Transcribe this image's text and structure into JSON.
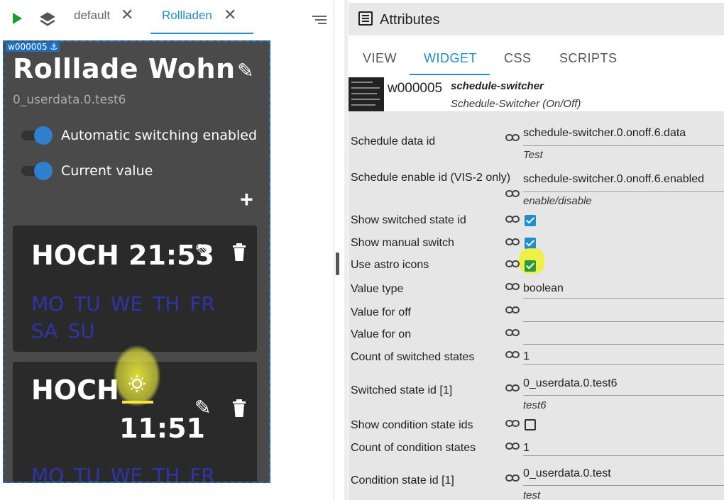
{
  "left_toolbar": {
    "play": "play-icon",
    "layers": "layers-icon",
    "tabs": [
      {
        "label": "default",
        "active": false
      },
      {
        "label": "Rollladen",
        "active": true
      }
    ],
    "menu": "menu-icon"
  },
  "widget": {
    "badge": "w000005 ⚓",
    "title": "Rolllade Wohn",
    "subtitle": "0_userdata.0.test6",
    "switches": [
      {
        "label": "Automatic switching enabled",
        "on": true
      },
      {
        "label": "Current value",
        "on": true
      }
    ],
    "cards": [
      {
        "title": "HOCH 21:53",
        "days_line1": [
          "MO",
          "TU",
          "WE",
          "TH",
          "FR"
        ],
        "days_line2": [
          "SA",
          "SU"
        ]
      },
      {
        "title": "HOCH",
        "time": "11:51",
        "astro": "sunrise-icon",
        "days_line1": [
          "MO",
          "TU",
          "WE",
          "TH",
          "FR"
        ]
      }
    ]
  },
  "attributes": {
    "title": "Attributes",
    "tabs": [
      "VIEW",
      "WIDGET",
      "CSS",
      "SCRIPTS"
    ],
    "active_tab": "WIDGET",
    "widget_id": "w000005",
    "widget_set": "schedule-switcher",
    "widget_type": "Schedule-Switcher (On/Off)",
    "rows": [
      {
        "label": "Schedule data id",
        "value": "schedule-switcher.0.onoff.6.data",
        "hint": "Test"
      },
      {
        "label": "Schedule enable id (VIS-2 only)",
        "value": "schedule-switcher.0.onoff.6.enabled",
        "hint": "enable/disable"
      },
      {
        "label": "Show switched state id",
        "checked": true
      },
      {
        "label": "Show manual switch",
        "checked": true
      },
      {
        "label": "Use astro icons",
        "checked": true
      },
      {
        "label": "Value type",
        "value": "boolean"
      },
      {
        "label": "Value for off",
        "value": ""
      },
      {
        "label": "Value for on",
        "value": ""
      },
      {
        "label": "Count of switched states",
        "value": "1"
      },
      {
        "label": "Switched state id [1]",
        "value": "0_userdata.0.test6",
        "hint": "test6"
      },
      {
        "label": "Show condition state ids",
        "checked": false
      },
      {
        "label": "Count of condition states",
        "value": "1"
      },
      {
        "label": "Condition state id [1]",
        "value": "0_userdata.0.test",
        "hint": "test"
      }
    ]
  },
  "colors": {
    "accent": "#1f8fd1",
    "widget_bg": "#4a4a4a",
    "card_bg": "#2a2a2a",
    "days": "#2e35a8",
    "highlight": "#f0f028"
  }
}
